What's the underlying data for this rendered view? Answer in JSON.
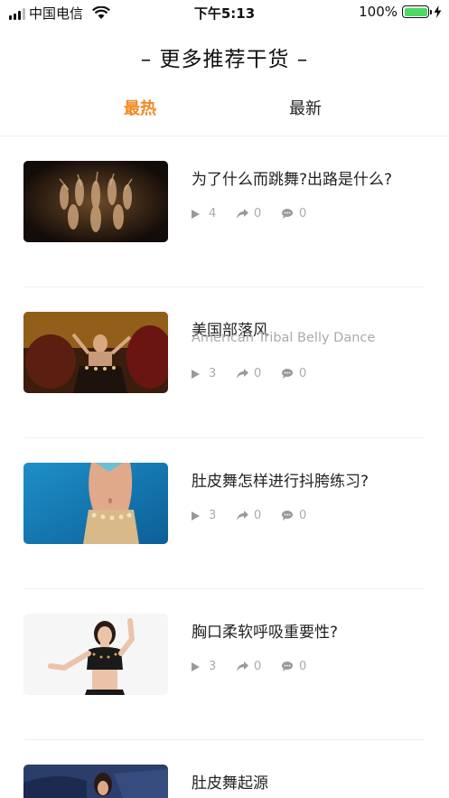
{
  "status_bar": {
    "carrier": "中国电信",
    "time": "下午5:13",
    "battery_percent": "100%",
    "battery_level": 1.0,
    "battery_color": "#4cd964"
  },
  "header": {
    "title": "– 更多推荐干货 –"
  },
  "tabs": [
    {
      "label": "最热",
      "active": true,
      "color": "#f08a24"
    },
    {
      "label": "最新",
      "active": false
    }
  ],
  "articles": [
    {
      "title": "为了什么而跳舞?出路是什么?",
      "subtitle": "",
      "plays": "4",
      "shares": "0",
      "comments": "0"
    },
    {
      "title": "美国部落风",
      "subtitle": "American Tribal Belly Dance",
      "plays": "3",
      "shares": "0",
      "comments": "0"
    },
    {
      "title": "肚皮舞怎样进行抖胯练习?",
      "subtitle": "",
      "plays": "3",
      "shares": "0",
      "comments": "0"
    },
    {
      "title": "胸口柔软呼吸重要性?",
      "subtitle": "",
      "plays": "3",
      "shares": "0",
      "comments": "0"
    },
    {
      "title": "肚皮舞起源",
      "subtitle": "",
      "plays": "",
      "shares": "",
      "comments": ""
    }
  ],
  "icons": {
    "play": "play-icon",
    "share": "share-icon",
    "comment": "comment-icon"
  }
}
